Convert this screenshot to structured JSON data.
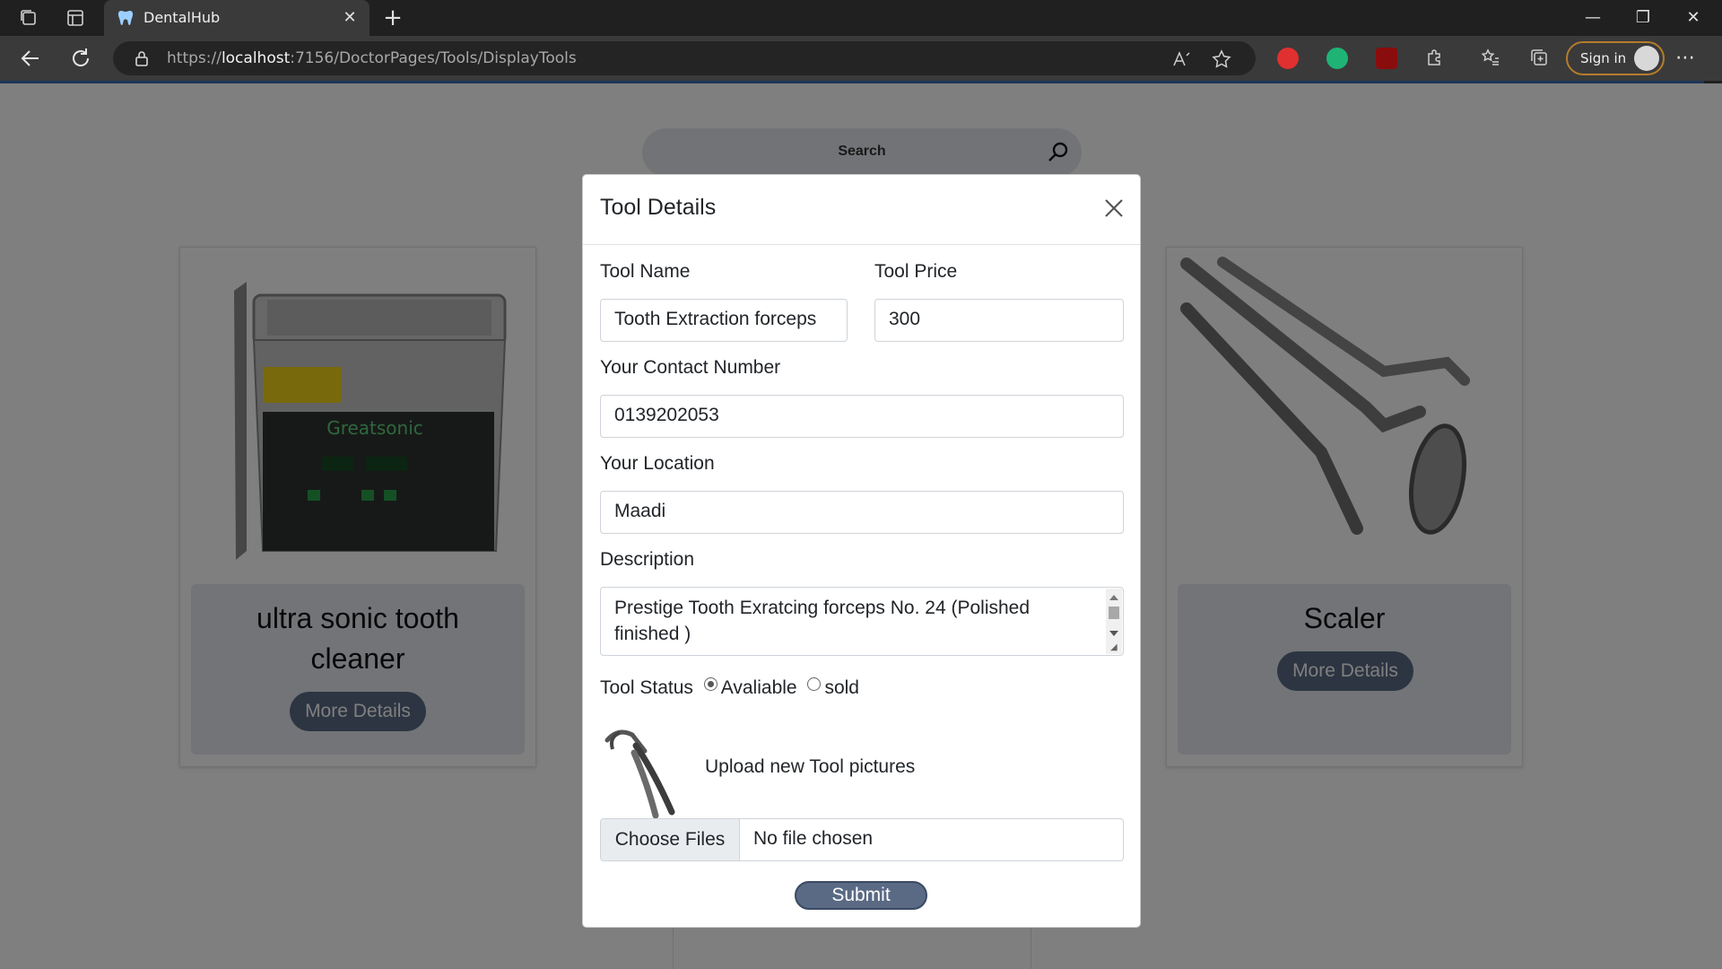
{
  "browser": {
    "tab_title": "DentalHub",
    "url_prefix": "https://",
    "url_host": "localhost",
    "url_rest": ":7156/DoctorPages/Tools/DisplayTools",
    "signin_label": "Sign in"
  },
  "page": {
    "search_placeholder": "Search",
    "cards": [
      {
        "title_line1": "ultra sonic tooth",
        "title_line2": "cleaner",
        "button": "More Details"
      },
      {
        "title_line1": "Scaler",
        "button": "More Details"
      }
    ]
  },
  "modal": {
    "title": "Tool Details",
    "tool_name_label": "Tool Name",
    "tool_name_value": "Tooth Extraction forceps",
    "tool_price_label": "Tool Price",
    "tool_price_value": "300",
    "contact_label": "Your Contact Number",
    "contact_value": "0139202053",
    "location_label": "Your Location",
    "location_value": "Maadi",
    "description_label": "Description",
    "description_value": "Prestige Tooth Exratcing forceps No. 24 (Polished finished )",
    "status_label": "Tool Status",
    "status_option_available": "Avaliable",
    "status_option_sold": "sold",
    "status_selected": "Avaliable",
    "upload_label": "Upload new Tool pictures",
    "file_button": "Choose Files",
    "file_status": "No file chosen",
    "submit_label": "Submit"
  },
  "colors": {
    "accent_line": "#1d3557",
    "button": "#5a6a84",
    "card_body": "#e4e9ef",
    "signin_border": "#b57c2c"
  }
}
